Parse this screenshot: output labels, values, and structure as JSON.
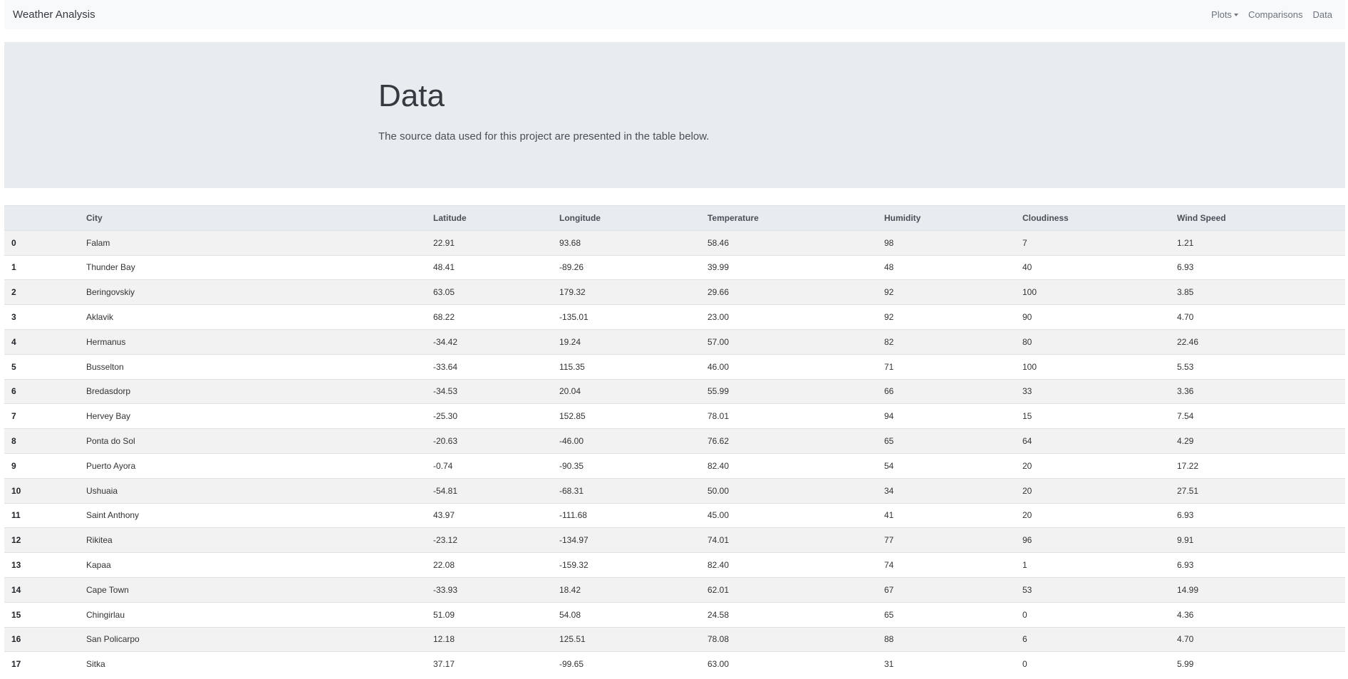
{
  "navbar": {
    "brand": "Weather Analysis",
    "links": {
      "plots": "Plots",
      "comparisons": "Comparisons",
      "data": "Data"
    }
  },
  "header": {
    "title": "Data",
    "lead": "The source data used for this project are presented in the table below."
  },
  "table": {
    "columns": [
      "",
      "City",
      "Latitude",
      "Longitude",
      "Temperature",
      "Humidity",
      "Cloudiness",
      "Wind Speed"
    ],
    "rows": [
      [
        "0",
        "Falam",
        "22.91",
        "93.68",
        "58.46",
        "98",
        "7",
        "1.21"
      ],
      [
        "1",
        "Thunder Bay",
        "48.41",
        "-89.26",
        "39.99",
        "48",
        "40",
        "6.93"
      ],
      [
        "2",
        "Beringovskiy",
        "63.05",
        "179.32",
        "29.66",
        "92",
        "100",
        "3.85"
      ],
      [
        "3",
        "Aklavik",
        "68.22",
        "-135.01",
        "23.00",
        "92",
        "90",
        "4.70"
      ],
      [
        "4",
        "Hermanus",
        "-34.42",
        "19.24",
        "57.00",
        "82",
        "80",
        "22.46"
      ],
      [
        "5",
        "Busselton",
        "-33.64",
        "115.35",
        "46.00",
        "71",
        "100",
        "5.53"
      ],
      [
        "6",
        "Bredasdorp",
        "-34.53",
        "20.04",
        "55.99",
        "66",
        "33",
        "3.36"
      ],
      [
        "7",
        "Hervey Bay",
        "-25.30",
        "152.85",
        "78.01",
        "94",
        "15",
        "7.54"
      ],
      [
        "8",
        "Ponta do Sol",
        "-20.63",
        "-46.00",
        "76.62",
        "65",
        "64",
        "4.29"
      ],
      [
        "9",
        "Puerto Ayora",
        "-0.74",
        "-90.35",
        "82.40",
        "54",
        "20",
        "17.22"
      ],
      [
        "10",
        "Ushuaia",
        "-54.81",
        "-68.31",
        "50.00",
        "34",
        "20",
        "27.51"
      ],
      [
        "11",
        "Saint Anthony",
        "43.97",
        "-111.68",
        "45.00",
        "41",
        "20",
        "6.93"
      ],
      [
        "12",
        "Rikitea",
        "-23.12",
        "-134.97",
        "74.01",
        "77",
        "96",
        "9.91"
      ],
      [
        "13",
        "Kapaa",
        "22.08",
        "-159.32",
        "82.40",
        "74",
        "1",
        "6.93"
      ],
      [
        "14",
        "Cape Town",
        "-33.93",
        "18.42",
        "62.01",
        "67",
        "53",
        "14.99"
      ],
      [
        "15",
        "Chingirlau",
        "51.09",
        "54.08",
        "24.58",
        "65",
        "0",
        "4.36"
      ],
      [
        "16",
        "San Policarpo",
        "12.18",
        "125.51",
        "78.08",
        "88",
        "6",
        "4.70"
      ],
      [
        "17",
        "Sitka",
        "37.17",
        "-99.65",
        "63.00",
        "31",
        "0",
        "5.99"
      ]
    ]
  }
}
